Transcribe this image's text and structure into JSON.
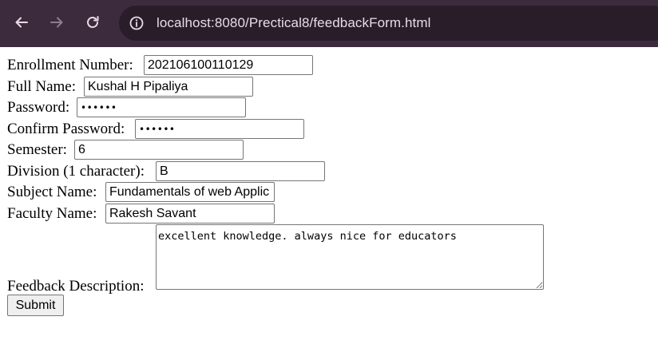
{
  "browser": {
    "url": "localhost:8080/Prectical8/feedbackForm.html",
    "toolbar_color": "#3c2b3c"
  },
  "form": {
    "enrollment_label": "Enrollment Number:",
    "enrollment_value": "202106100110129",
    "fullname_label": "Full Name:",
    "fullname_value": "Kushal H Pipaliya",
    "password_label": "Password:",
    "password_value": "••••••",
    "confirm_label": "Confirm Password:",
    "confirm_value": "••••••",
    "semester_label": "Semester:",
    "semester_value": "6",
    "division_label": "Division (1 character):",
    "division_value": "B",
    "subject_label": "Subject Name:",
    "subject_value": "Fundamentals of web Applic",
    "faculty_label": "Faculty Name:",
    "faculty_value": "Rakesh Savant",
    "feedback_label": "Feedback Description:",
    "feedback_value": "excellent knowledge. always nice for educators",
    "submit_label": "Submit"
  }
}
